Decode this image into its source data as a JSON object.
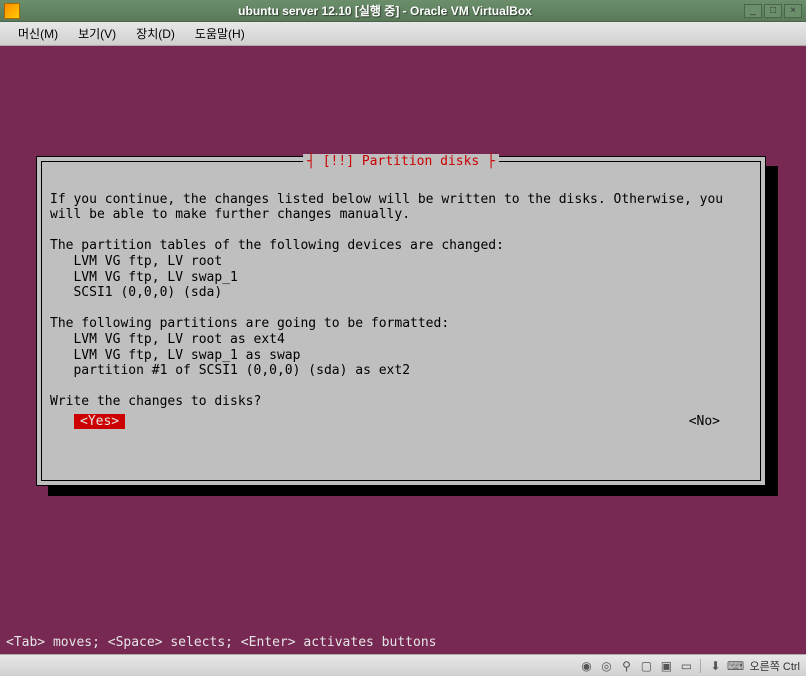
{
  "titlebar": {
    "title": "ubuntu server 12.10 [실행 중] - Oracle VM VirtualBox",
    "minimize": "_",
    "maximize": "□",
    "close": "×"
  },
  "menubar": {
    "machine": "머신(M)",
    "view": "보기(V)",
    "devices": "장치(D)",
    "help": "도움말(H)"
  },
  "dialog": {
    "title": "[!!] Partition disks",
    "intro": "If you continue, the changes listed below will be written to the disks. Otherwise, you will be able to make further changes manually.",
    "tables_header": "The partition tables of the following devices are changed:",
    "tables_item1": "   LVM VG ftp, LV root",
    "tables_item2": "   LVM VG ftp, LV swap_1",
    "tables_item3": "   SCSI1 (0,0,0) (sda)",
    "format_header": "The following partitions are going to be formatted:",
    "format_item1": "   LVM VG ftp, LV root as ext4",
    "format_item2": "   LVM VG ftp, LV swap_1 as swap",
    "format_item3": "   partition #1 of SCSI1 (0,0,0) (sda) as ext2",
    "question": "Write the changes to disks?",
    "yes": "<Yes>",
    "no": "<No>"
  },
  "helpbar": "<Tab> moves; <Space> selects; <Enter> activates buttons",
  "statusbar": {
    "host_key": "오른쪽 Ctrl"
  }
}
